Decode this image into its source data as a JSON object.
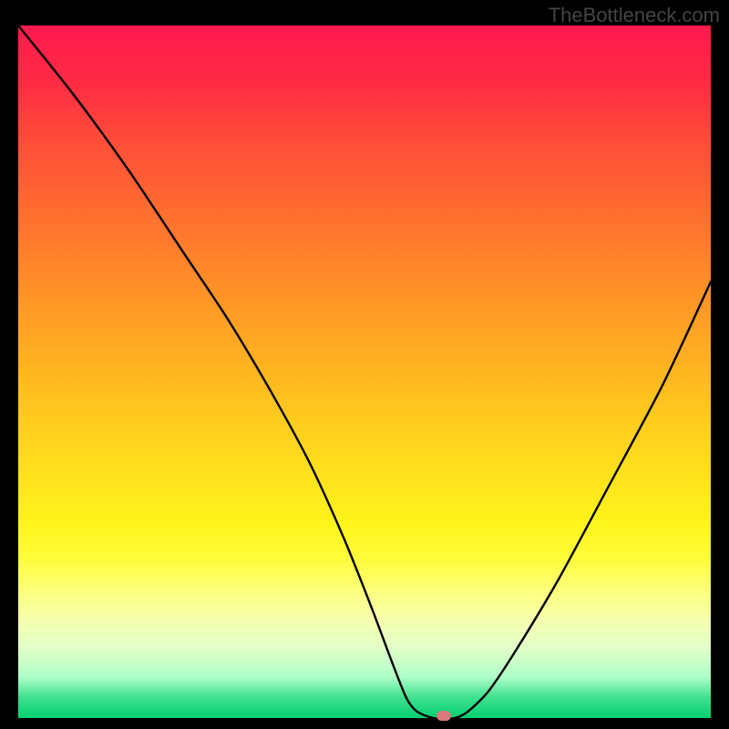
{
  "watermark": "TheBottleneck.com",
  "chart_data": {
    "type": "line",
    "title": "",
    "xlabel": "",
    "ylabel": "",
    "xlim": [
      0,
      100
    ],
    "ylim": [
      0,
      100
    ],
    "x": [
      0,
      8,
      16,
      24,
      30,
      36,
      42,
      47,
      51,
      54,
      56,
      57.5,
      60,
      63,
      65,
      68,
      72,
      78,
      85,
      93,
      100
    ],
    "values": [
      100,
      90,
      79,
      67,
      58,
      48,
      37,
      26,
      16,
      8,
      3,
      1,
      0,
      0,
      1,
      4,
      10,
      20,
      33,
      48,
      63
    ],
    "marker": {
      "x": 61.5,
      "y": 0.4
    },
    "gradient_stops": [
      {
        "pct": 0,
        "color": "#ff1a4d"
      },
      {
        "pct": 50,
        "color": "#ffc020"
      },
      {
        "pct": 80,
        "color": "#fff860"
      },
      {
        "pct": 100,
        "color": "#00d070"
      }
    ]
  }
}
